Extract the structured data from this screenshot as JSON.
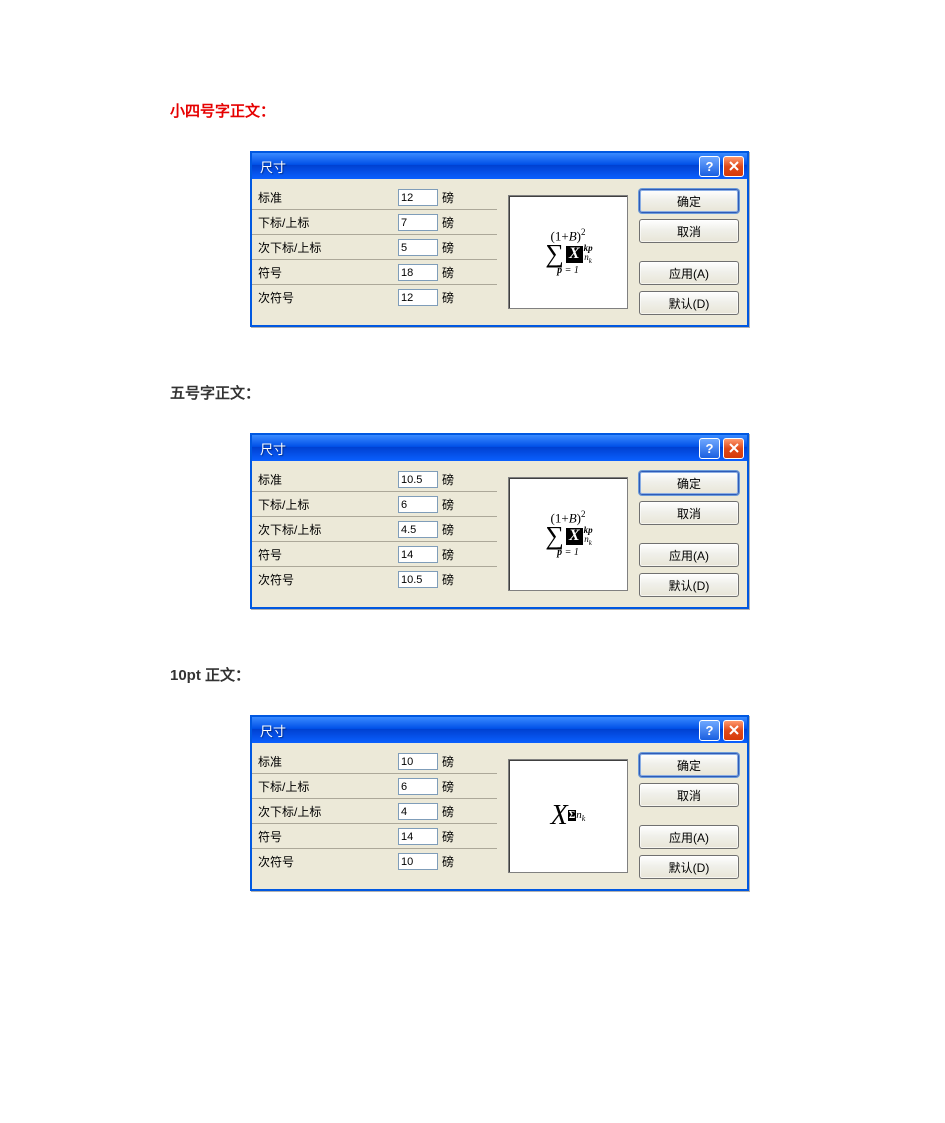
{
  "headings": {
    "h1": "小四号字正文：",
    "h2": "五号字正文：",
    "h3": "10pt 正文："
  },
  "dialog_title": "尺寸",
  "help_glyph": "?",
  "unit": "磅",
  "field_labels": {
    "standard": "标准",
    "subsup": "下标/上标",
    "subsubsup": "次下标/上标",
    "symbol": "符号",
    "subsymbol": "次符号"
  },
  "buttons": {
    "ok": "确定",
    "cancel": "取消",
    "apply": "应用(A)",
    "default": "默认(D)"
  },
  "preview_type_full": "full",
  "preview_type_simple": "simple",
  "dialogs": [
    {
      "values": {
        "standard": "12",
        "subsup": "7",
        "subsubsup": "5",
        "symbol": "18",
        "subsymbol": "12"
      },
      "preview": "full"
    },
    {
      "values": {
        "standard": "10.5",
        "subsup": "6",
        "subsubsup": "4.5",
        "symbol": "14",
        "subsymbol": "10.5"
      },
      "preview": "full"
    },
    {
      "values": {
        "standard": "10",
        "subsup": "6",
        "subsubsup": "4",
        "symbol": "14",
        "subsymbol": "10"
      },
      "preview": "simple"
    }
  ]
}
